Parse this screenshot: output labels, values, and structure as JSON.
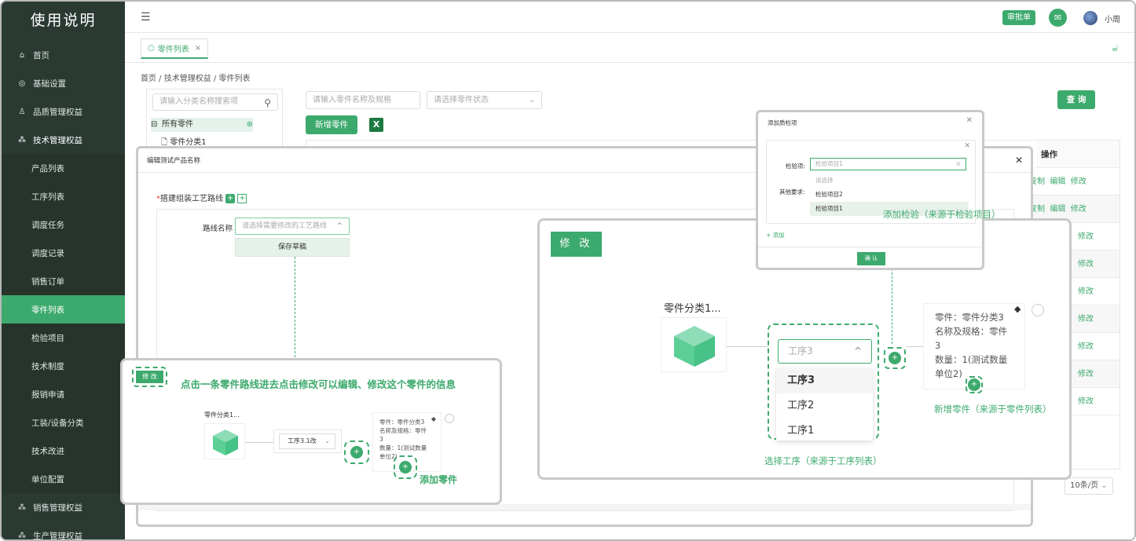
{
  "sidebar": {
    "title": "使用说明",
    "items": [
      {
        "label": "首页",
        "icon": "home-icon"
      },
      {
        "label": "基础设置",
        "icon": "settings-icon"
      },
      {
        "label": "品质管理权益",
        "icon": "user-icon"
      },
      {
        "label": "技术管理权益",
        "icon": "grid-icon"
      },
      {
        "label": "产品列表"
      },
      {
        "label": "工序列表"
      },
      {
        "label": "调度任务"
      },
      {
        "label": "调度记录"
      },
      {
        "label": "销售订单"
      },
      {
        "label": "零件列表"
      },
      {
        "label": "检验项目"
      },
      {
        "label": "技术制度"
      },
      {
        "label": "报销申请"
      },
      {
        "label": "工装/设备分类"
      },
      {
        "label": "技术改进"
      },
      {
        "label": "单位配置"
      },
      {
        "label": "销售管理权益",
        "icon": "grid-icon"
      },
      {
        "label": "生产管理权益",
        "icon": "grid-icon"
      }
    ]
  },
  "header": {
    "approve_label": "审批单",
    "username": "小周"
  },
  "tabs": [
    {
      "label": "零件列表"
    }
  ],
  "breadcrumb": "首页 / 技术管理权益 / 零件列表",
  "tree": {
    "search_placeholder": "请输入分类名称搜索项",
    "root": "所有零件",
    "child": "零件分类1"
  },
  "filters": {
    "name_placeholder": "请输入零件名称及规格",
    "status_placeholder": "请选择零件状态",
    "query_label": "查 询",
    "add_label": "新增零件"
  },
  "table": {
    "ops_header": "操作",
    "rows": [
      {
        "ops": [
          "复制",
          "编辑",
          "修改"
        ]
      },
      {
        "ops": [
          "复制",
          "编辑",
          "修改"
        ]
      },
      {
        "ops": [
          "修改"
        ]
      },
      {
        "ops": [
          "修改"
        ]
      },
      {
        "ops": [
          "修改"
        ]
      },
      {
        "ops": [
          "修改"
        ]
      },
      {
        "ops": [
          "修改"
        ]
      },
      {
        "ops": [
          "修改"
        ]
      },
      {
        "ops": [
          "修改"
        ]
      }
    ],
    "page_size": "10条/页"
  },
  "edit_dialog": {
    "title": "编辑测试产品名称",
    "route_label": "搭建组装工艺路线",
    "route_name_label": "路线名称",
    "route_placeholder": "请选择需要修改的工艺路线",
    "save_draft": "保存草稿"
  },
  "callout_left": {
    "modify": "修 改",
    "instruction": "点击一条零件路线进去点击修改可以编辑、修改这个零件的信息",
    "part_name": "零件分类1...",
    "process_value": "工序3.1改",
    "info": [
      "零件：零件分类3",
      "名称及规格：零件",
      "3",
      "数量：1(测试数量",
      "单位2)"
    ],
    "add_part": "添加零件"
  },
  "callout_right": {
    "modify": "修 改",
    "part_name": "零件分类1...",
    "process_placeholder": "工序3",
    "options": [
      "工序3",
      "工序2",
      "工序1"
    ],
    "select_caption": "选择工序（来源于工序列表）",
    "info": [
      "零件：零件分类3",
      "名称及规格：零件",
      "3",
      "数量：1(测试数量",
      "单位2)"
    ],
    "add_caption": "新增零件（来源于零件列表）"
  },
  "qc_dialog": {
    "title": "添加质检项",
    "item_label": "检验项:",
    "item_placeholder": "检验项目1",
    "other_label": "其他要求:",
    "options": [
      "请选择",
      "检验项目2",
      "检验项目1"
    ],
    "caption": "添加检验（来源于检验项目）",
    "add": "+ 添加",
    "confirm": "确 认"
  },
  "colors": {
    "accent": "#3daa6d",
    "sidebar": "#2a3a32"
  }
}
